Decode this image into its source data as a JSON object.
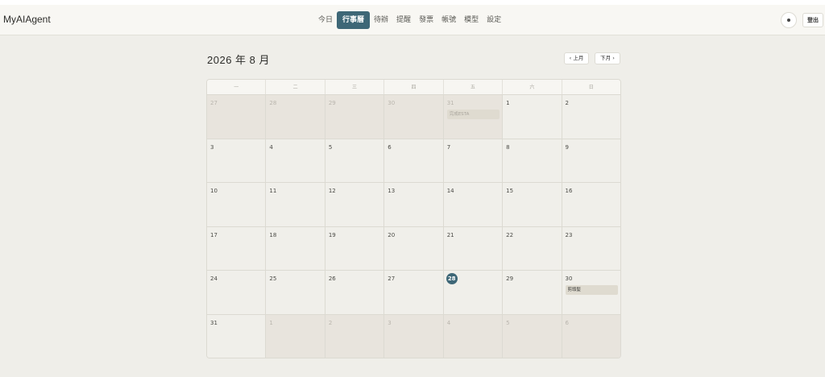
{
  "app": {
    "brand": "MyAIAgent"
  },
  "nav": {
    "items": [
      "今日",
      "行事曆",
      "待辦",
      "提醒",
      "發票",
      "帳號",
      "模型",
      "設定"
    ],
    "active_index": 1
  },
  "user": {
    "logout_label": "登出"
  },
  "calendar": {
    "month_title": "2026 年 8 月",
    "prev_label": "‹ 上月",
    "next_label": "下月 ›",
    "weekdays": [
      "一",
      "二",
      "三",
      "四",
      "五",
      "六",
      "日"
    ],
    "weeks": [
      [
        {
          "d": "27",
          "other": true
        },
        {
          "d": "28",
          "other": true
        },
        {
          "d": "29",
          "other": true
        },
        {
          "d": "30",
          "other": true
        },
        {
          "d": "31",
          "other": true,
          "event": "完成ESTA"
        },
        {
          "d": "1"
        },
        {
          "d": "2"
        }
      ],
      [
        {
          "d": "3"
        },
        {
          "d": "4"
        },
        {
          "d": "5"
        },
        {
          "d": "6"
        },
        {
          "d": "7"
        },
        {
          "d": "8"
        },
        {
          "d": "9"
        }
      ],
      [
        {
          "d": "10"
        },
        {
          "d": "11"
        },
        {
          "d": "12"
        },
        {
          "d": "13"
        },
        {
          "d": "14"
        },
        {
          "d": "15"
        },
        {
          "d": "16"
        }
      ],
      [
        {
          "d": "17"
        },
        {
          "d": "18"
        },
        {
          "d": "19"
        },
        {
          "d": "20"
        },
        {
          "d": "21"
        },
        {
          "d": "22"
        },
        {
          "d": "23"
        }
      ],
      [
        {
          "d": "24"
        },
        {
          "d": "25"
        },
        {
          "d": "26"
        },
        {
          "d": "27"
        },
        {
          "d": "28",
          "today": true
        },
        {
          "d": "29"
        },
        {
          "d": "30",
          "event": "剪頭髮"
        }
      ],
      [
        {
          "d": "31"
        },
        {
          "d": "1",
          "other": true
        },
        {
          "d": "2",
          "other": true
        },
        {
          "d": "3",
          "other": true
        },
        {
          "d": "4",
          "other": true
        },
        {
          "d": "5",
          "other": true
        },
        {
          "d": "6",
          "other": true
        }
      ]
    ]
  },
  "colors": {
    "accent": "#3e6777",
    "background": "#efeee9",
    "other_month": "#e8e4dd",
    "event_bg": "#dfdbd0"
  }
}
